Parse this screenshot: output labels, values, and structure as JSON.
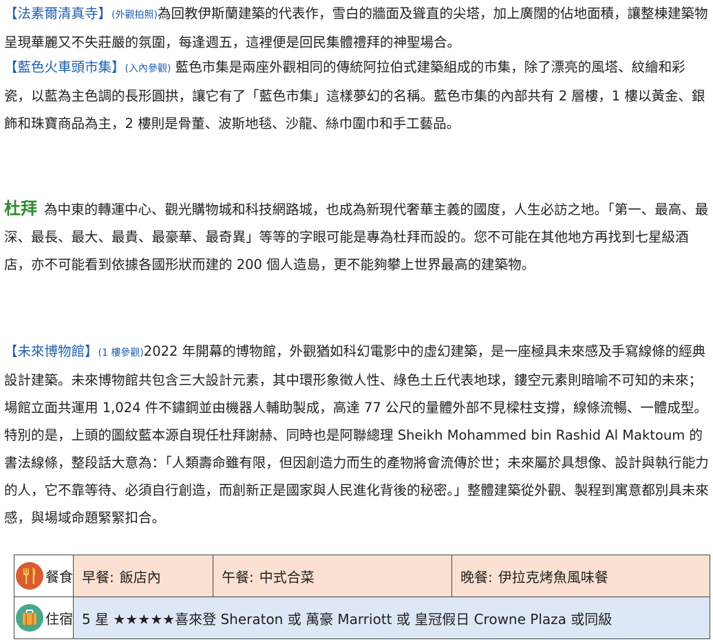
{
  "colors": {
    "tag_blue": "#1f5fb0",
    "dubai_green": "#2e8b2e",
    "meal_bg": "#fbe1d2",
    "stay_bg": "#dde7f5",
    "meal_icon": "#d95c32",
    "stay_icon": "#4aa78a"
  },
  "para1": {
    "tag": "【法素爾清真寺】",
    "note": "(外觀拍照)",
    "text": "為回教伊斯蘭建築的代表作，雪白的牆面及聳直的尖塔，加上廣闊的佔地面積，讓整棟建築物呈現華麗又不失莊嚴的氛圍，每逢週五，這裡便是回民集體禮拜的神聖場合。"
  },
  "para2": {
    "tag": "【藍色火車頭市集】",
    "note": "(入內參觀)",
    "text": " 藍色市集是兩座外觀相同的傳統阿拉伯式建築組成的市集，除了漂亮的風塔、紋繪和彩瓷，以藍為主色調的長形圓拱，讓它有了「藍色市集」這樣夢幻的名稱。藍色市集的內部共有 2 層樓，1 樓以黃金、銀飾和珠寶商品為主，2 樓則是骨董、波斯地毯、沙龍、絲巾圍巾和手工藝品。"
  },
  "dubai": {
    "title": "杜拜",
    "text": "為中東的轉運中心、觀光購物城和科技網路城，也成為新現代奢華主義的國度，人生必訪之地。「第一、最高、最深、最長、最大、最貴、最豪華、最奇異」等等的字眼可能是專為杜拜而設的。您不可能在其他地方再找到七星級酒店，亦不可能看到依據各國形狀而建的 200 個人造島，更不能夠攀上世界最高的建築物。"
  },
  "museum": {
    "tag": "【未來博物館】",
    "note": "(1 樓參觀)",
    "text": "2022 年開幕的博物館，外觀猶如科幻電影中的虛幻建築，是一座極具未來感及手寫線條的經典設計建築。未來博物館共包含三大設計元素，其中環形象徵人性、綠色土丘代表地球，鏤空元素則暗喻不可知的未來；場館立面共運用 1,024 件不鏽鋼並由機器人輔助製成，高達 77 公尺的量體外部不見樑柱支撐，線條流暢、一體成型。",
    "text2": "特別的是，上頭的圖紋藍本源自現任杜拜謝赫、同時也是阿聯總理 Sheikh Mohammed bin Rashid Al Maktoum 的書法線條，整段話大意為：「人類壽命雖有限，但因創造力而生的產物將會流傳於世；未來屬於具想像、設計與執行能力的人，它不靠等待、必須自行創造，而創新正是國家與人民進化背後的秘密。」整體建築從外觀、製程到寓意都別具未來感，與場域命題緊緊扣合。"
  },
  "meals": {
    "label": "餐食",
    "icon": "fork-knife-icon",
    "breakfast_label": "早餐:",
    "breakfast": "飯店內",
    "lunch_label": "午餐:",
    "lunch": "中式合菜",
    "dinner_label": "晚餐:",
    "dinner": "伊拉克烤魚風味餐"
  },
  "stay": {
    "label": "住宿",
    "icon": "luggage-icon",
    "text": "5 星 ★★★★★喜來登 Sheraton 或 萬豪 Marriott 或 皇冠假日 Crowne Plaza 或同級"
  }
}
